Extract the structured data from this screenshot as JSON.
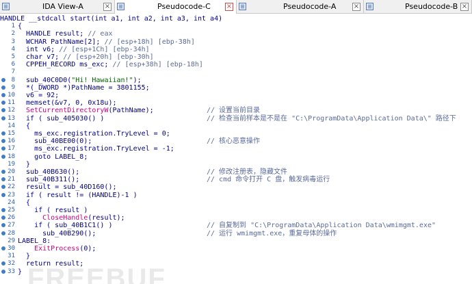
{
  "tabs": [
    {
      "label": "IDA View-A",
      "close": "×",
      "active": false
    },
    {
      "label": "Pseudocode-C",
      "close": "×",
      "active": true
    },
    {
      "label": "Pseudocode-A",
      "close": "×",
      "active": false
    },
    {
      "label": "Pseudocode-B",
      "close": "×",
      "active": false
    }
  ],
  "code": {
    "lines": [
      {
        "num": "",
        "bp": false,
        "text": "HANDLE __stdcall start(int a1, int a2, int a3, int a4)",
        "comment": ""
      },
      {
        "num": "1",
        "bp": false,
        "text": "{",
        "comment": ""
      },
      {
        "num": "2",
        "bp": false,
        "text": "  HANDLE result; // eax",
        "comment": ""
      },
      {
        "num": "3",
        "bp": false,
        "text": "  WCHAR PathName[2]; // [esp+18h] [ebp-38h]",
        "comment": ""
      },
      {
        "num": "4",
        "bp": false,
        "text": "  int v6; // [esp+1Ch] [ebp-34h]",
        "comment": ""
      },
      {
        "num": "5",
        "bp": false,
        "text": "  char v7; // [esp+20h] [ebp-30h]",
        "comment": ""
      },
      {
        "num": "6",
        "bp": false,
        "text": "  CPPEH_RECORD ms_exc; // [esp+38h] [ebp-18h]",
        "comment": ""
      },
      {
        "num": "7",
        "bp": false,
        "text": "",
        "comment": ""
      },
      {
        "num": "8",
        "bp": true,
        "text": "  sub_40C0D0(\"Hi! Hawaiian!\");",
        "comment": ""
      },
      {
        "num": "9",
        "bp": true,
        "text": "  *(_DWORD *)PathName = 3801155;",
        "comment": ""
      },
      {
        "num": "10",
        "bp": true,
        "text": "  v6 = 92;",
        "comment": ""
      },
      {
        "num": "11",
        "bp": true,
        "text": "  memset(&v7, 0, 0x18u);",
        "comment": ""
      },
      {
        "num": "12",
        "bp": true,
        "text": "  SetCurrentDirectoryW(PathName);",
        "comment": "// 设置当前目录"
      },
      {
        "num": "13",
        "bp": true,
        "text": "  if ( sub_405030() )",
        "comment": "// 检查当前样本是不是在 \"C:\\ProgramData\\Application Data\\\" 路径下"
      },
      {
        "num": "14",
        "bp": false,
        "text": "  {",
        "comment": ""
      },
      {
        "num": "15",
        "bp": true,
        "text": "    ms_exc.registration.TryLevel = 0;",
        "comment": ""
      },
      {
        "num": "16",
        "bp": true,
        "text": "    sub_40BE00(0);",
        "comment": "// 核心恶意操作"
      },
      {
        "num": "17",
        "bp": true,
        "text": "    ms_exc.registration.TryLevel = -1;",
        "comment": ""
      },
      {
        "num": "18",
        "bp": true,
        "text": "    goto LABEL_8;",
        "comment": ""
      },
      {
        "num": "19",
        "bp": false,
        "text": "  }",
        "comment": ""
      },
      {
        "num": "20",
        "bp": true,
        "text": "  sub_40B630();",
        "comment": "// 修改注册表，隐藏文件"
      },
      {
        "num": "21",
        "bp": true,
        "text": "  sub_40B311();",
        "comment": "// cmd 命令打开 C 盘，触发病毒运行"
      },
      {
        "num": "22",
        "bp": true,
        "text": "  result = sub_40D160();",
        "comment": ""
      },
      {
        "num": "23",
        "bp": true,
        "text": "  if ( result != (HANDLE)-1 )",
        "comment": ""
      },
      {
        "num": "24",
        "bp": false,
        "text": "  {",
        "comment": ""
      },
      {
        "num": "25",
        "bp": true,
        "text": "    if ( result )",
        "comment": ""
      },
      {
        "num": "26",
        "bp": true,
        "text": "      CloseHandle(result);",
        "comment": ""
      },
      {
        "num": "27",
        "bp": true,
        "text": "    if ( sub_40B1C1() )",
        "comment": "// 自复制到 \"C:\\ProgramData\\Application Data\\wmimgmt.exe\""
      },
      {
        "num": "28",
        "bp": true,
        "text": "      sub_40B290();",
        "comment": "// 运行 wmimgmt.exe，重复母体的操作"
      },
      {
        "num": "29",
        "bp": false,
        "text": "LABEL_8:",
        "comment": ""
      },
      {
        "num": "30",
        "bp": true,
        "text": "    ExitProcess(0);",
        "comment": ""
      },
      {
        "num": "31",
        "bp": false,
        "text": "  }",
        "comment": ""
      },
      {
        "num": "32",
        "bp": true,
        "text": "  return result;",
        "comment": ""
      },
      {
        "num": "33",
        "bp": true,
        "text": "}",
        "comment": ""
      }
    ]
  },
  "watermark": "FREEBUF",
  "colors": {
    "code_text": "#000080",
    "string": "#006400",
    "api_call": "#c80082",
    "comment": "#5a6a9a",
    "breakpoint": "#3f7ec7"
  }
}
